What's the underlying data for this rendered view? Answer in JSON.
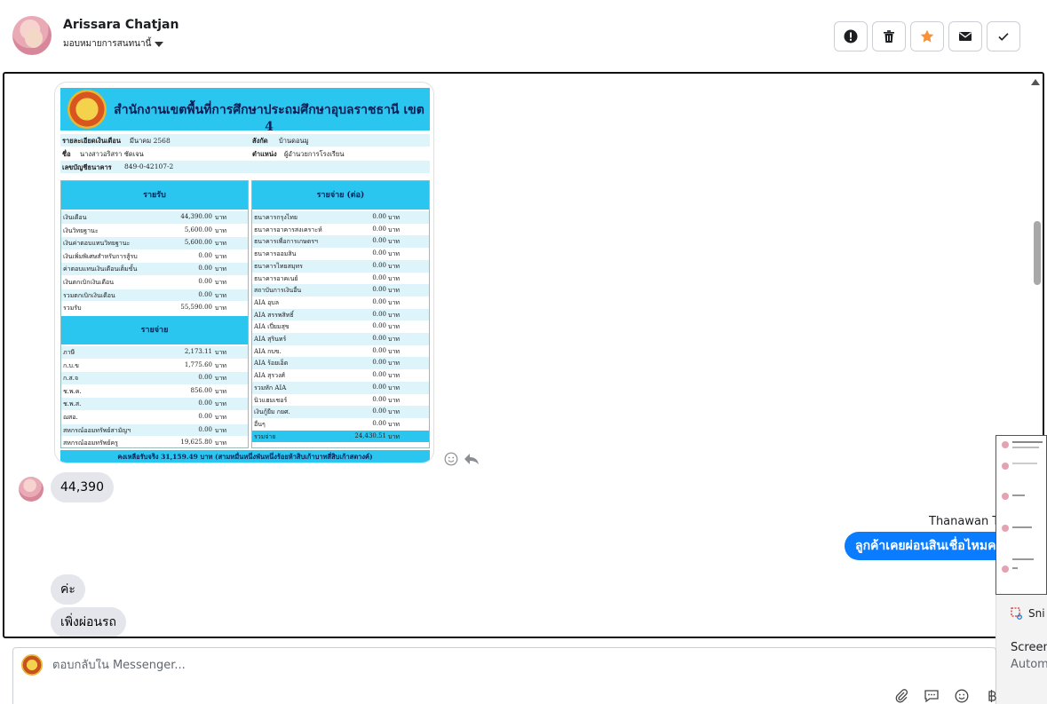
{
  "header": {
    "user_name": "Arissara Chatjan",
    "assign_label": "มอบหมายการสนทนานี้"
  },
  "actions": [
    {
      "name": "mark-spam-button",
      "icon": "alert-icon"
    },
    {
      "name": "delete-button",
      "icon": "trash-icon"
    },
    {
      "name": "star-button",
      "icon": "star-icon"
    },
    {
      "name": "mark-unread-button",
      "icon": "envelope-icon"
    },
    {
      "name": "mark-done-button",
      "icon": "check-icon"
    }
  ],
  "slip": {
    "title": "สำนักงานเขตพื้นที่การศึกษาประถมศึกษาอุบลราชธานี เขต 4",
    "info": {
      "detail_label": "รายละเอียดเงินเดือน",
      "month": "มีนาคม 2568",
      "affiliation_label": "สังกัด",
      "affiliation": "บ้านดอนมู",
      "name_label": "ชื่อ",
      "name": "นางสาวอริสรา ชัดเจน",
      "position_label": "ตำแหน่ง",
      "position": "ผู้อำนวยการโรงเรียน",
      "account_label": "เลขบัญชีธนาคาร",
      "account": "849-0-42107-2"
    },
    "unit": "บาท",
    "income_title": "รายรับ",
    "income": [
      {
        "label": "เงินเดือน",
        "amount": "44,390.00"
      },
      {
        "label": "เงินวิทยฐานะ",
        "amount": "5,600.00"
      },
      {
        "label": "เงินค่าตอบแทนวิทยฐานะ",
        "amount": "5,600.00"
      },
      {
        "label": "เงินเพิ่มพิเศษสำหรับการสู้รบ",
        "amount": "0.00"
      },
      {
        "label": "ค่าตอบแทนเงินเดือนเต็มขั้น",
        "amount": "0.00"
      },
      {
        "label": "เงินตกเบิกเงินเดือน",
        "amount": "0.00"
      },
      {
        "label": "รวมตกเบิกเงินเดือน",
        "amount": "0.00"
      },
      {
        "label": "รวมรับ",
        "amount": "55,590.00"
      }
    ],
    "expense_title": "รายจ่าย",
    "expense": [
      {
        "label": "ภาษี",
        "amount": "2,173.11"
      },
      {
        "label": "ก.บ.ข",
        "amount": "1,775.60"
      },
      {
        "label": "ก.ส.จ",
        "amount": "0.00"
      },
      {
        "label": "ช.พ.ค.",
        "amount": "856.00"
      },
      {
        "label": "ช.พ.ส.",
        "amount": "0.00"
      },
      {
        "label": "ฌสอ.",
        "amount": "0.00"
      },
      {
        "label": "สหกรณ์ออมทรัพย์สามัญฯ",
        "amount": "0.00"
      },
      {
        "label": "สหกรณ์ออมทรัพย์ครู",
        "amount": "19,625.80"
      }
    ],
    "expense_cont_title": "รายจ่าย (ต่อ)",
    "expense_cont": [
      {
        "label": "ธนาคารกรุงไทย",
        "amount": "0.00"
      },
      {
        "label": "ธนาคารอาคารสงเคราะห์",
        "amount": "0.00"
      },
      {
        "label": "ธนาคารเพื่อการเกษตรฯ",
        "amount": "0.00"
      },
      {
        "label": "ธนาคารออมสิน",
        "amount": "0.00"
      },
      {
        "label": "ธนาคารไทยสมุทร",
        "amount": "0.00"
      },
      {
        "label": "ธนาคารอาคเนย์",
        "amount": "0.00"
      },
      {
        "label": "สถาบันการเงินอื่น",
        "amount": "0.00"
      },
      {
        "label": "AIA อุบล",
        "amount": "0.00"
      },
      {
        "label": "AIA สรรพสิทธิ์",
        "amount": "0.00"
      },
      {
        "label": "AIA เปี่ยมสุข",
        "amount": "0.00"
      },
      {
        "label": "AIA สุรินทร์",
        "amount": "0.00"
      },
      {
        "label": "AIA กบข.",
        "amount": "0.00"
      },
      {
        "label": "AIA ร้อยเอ็ด",
        "amount": "0.00"
      },
      {
        "label": "AIA สุรวงศ์",
        "amount": "0.00"
      },
      {
        "label": "รวมหัก AIA",
        "amount": "0.00"
      },
      {
        "label": "นิวแฮมเชอร์",
        "amount": "0.00"
      },
      {
        "label": "เงินกู้ยืม กยศ.",
        "amount": "0.00"
      },
      {
        "label": "อื่นๆ",
        "amount": "0.00"
      },
      {
        "label": "รวมจ่าย",
        "amount": "24,430.51"
      }
    ],
    "footer": "คงเหลือรับจริง    31,159.49  บาท   (สามหมื่นหนึ่งพันหนึ่งร้อยห้าสิบเก้าบาทสี่สิบเก้าสตางค์)"
  },
  "messages": {
    "in_1": "44,390",
    "out_sender": "Thanawan Tho",
    "out_1": "ลูกค้าเคยผ่อนสินเชื่อไหมคะ",
    "in_2": "ค่ะ",
    "in_3": "เพิ่งผ่อนรถ"
  },
  "snip": {
    "app": "Sni",
    "line1": "Screen",
    "line2": "Autom"
  },
  "reply": {
    "placeholder": "ตอบกลับใน Messenger..."
  }
}
